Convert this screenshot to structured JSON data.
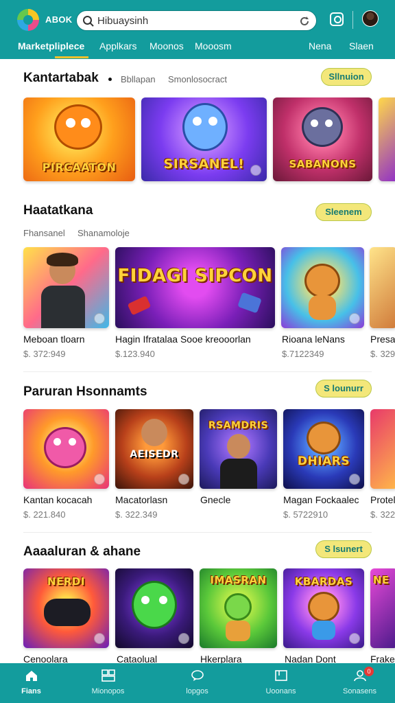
{
  "header": {
    "brand": "ABOK",
    "search": {
      "value": "Hibuaysinh",
      "placeholder": "Hibuaysinh"
    },
    "tabs": [
      {
        "label": "Marketpliplece",
        "active": true
      },
      {
        "label": "Applkars",
        "active": false
      },
      {
        "label": "Moonos",
        "active": false
      },
      {
        "label": "Mooosm",
        "active": false
      },
      {
        "label": "Nena",
        "active": false
      },
      {
        "label": "Slaen",
        "active": false
      }
    ]
  },
  "sections": [
    {
      "title": "Kantartabak",
      "subs": [
        "Bbllapan",
        "Smonlosocract"
      ],
      "button": "Sllnuion",
      "cards": [
        {
          "art": "PIRCAATON"
        },
        {
          "art": "SIRSANEL!"
        },
        {
          "art": "SABANONS"
        }
      ]
    },
    {
      "title": "Haatatkana",
      "subs": [
        "Fhansanel",
        "Shanamoloje"
      ],
      "button": "Sleenem",
      "cards": [
        {
          "title": "Meboan tloarn",
          "price": "$. 372:949"
        },
        {
          "title": "Hagin Ifratalaa Sooe kreooorlan",
          "price": "$.123.940",
          "art": "FIDAGI SIPCON"
        },
        {
          "title": "Rioana leNans",
          "price": "$.7122349"
        },
        {
          "title": "Presa",
          "price": "$. 329"
        }
      ]
    },
    {
      "title": "Paruran Hsonnamts",
      "button": "S lounurr",
      "cards": [
        {
          "title": "Kantan kocacah",
          "price": "$. 221.840"
        },
        {
          "title": "Macatorlasn",
          "price": "$. 322.349",
          "art": "AEISEDR"
        },
        {
          "title": "Gnecle",
          "art": "RSAMDRIS"
        },
        {
          "title": "Magan Fockaalec",
          "price": "$. 5722910",
          "art": "DHIARS"
        },
        {
          "title": "Protel",
          "price": "$. 322"
        }
      ]
    },
    {
      "title": "Aaaaluran & ahane",
      "button": "S lsunert",
      "cards": [
        {
          "title": "Cenoolara",
          "art": "NERDI"
        },
        {
          "title": "Cataolual"
        },
        {
          "title": "Hkerplara",
          "art": "IMASRAN"
        },
        {
          "title": "Nadan Dont",
          "art": "KBARDAS"
        },
        {
          "title": "Frake",
          "art": "NE"
        }
      ]
    }
  ],
  "bottom_nav": [
    {
      "label": "Fians",
      "icon": "home-icon",
      "active": true
    },
    {
      "label": "Mionopos",
      "icon": "grid-icon",
      "active": false
    },
    {
      "label": "lopgos",
      "icon": "chat-icon",
      "active": false
    },
    {
      "label": "Uoonans",
      "icon": "box-icon",
      "active": false
    },
    {
      "label": "Sonasens",
      "icon": "person-icon",
      "active": false,
      "badge": "0"
    }
  ],
  "colors": {
    "header": "#139c9d",
    "accent": "#f1c02c",
    "button": "#f3e77a"
  }
}
